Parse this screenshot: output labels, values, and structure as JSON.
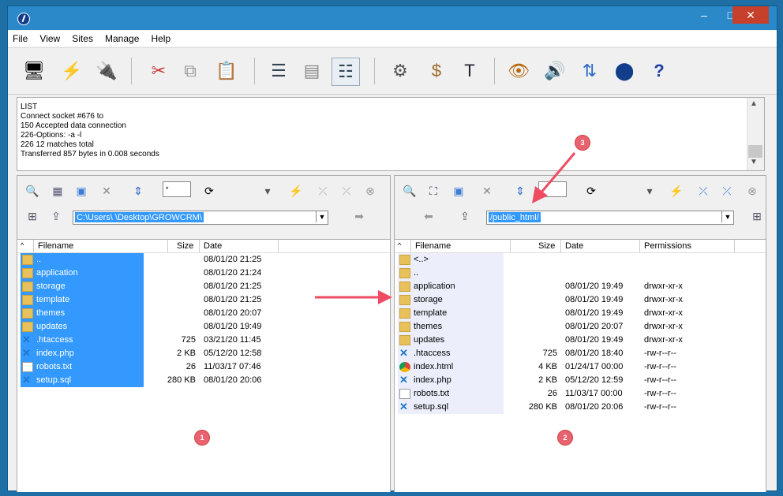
{
  "window": {
    "controls": {
      "minimize": "–",
      "maximize": "□",
      "close": "✕"
    }
  },
  "menu": [
    "File",
    "View",
    "Sites",
    "Manage",
    "Help"
  ],
  "toolbar_icons": [
    "site-manager-icon",
    "quick-connect-icon",
    "disconnect-icon",
    "cut-icon",
    "copy-icon",
    "paste-icon",
    "view-list-icon",
    "view-details-icon",
    "view-report-icon",
    "settings-icon",
    "scheduler-icon",
    "terminal-icon",
    "watch-icon",
    "sound-icon",
    "transfer-icon",
    "about-icon",
    "help-icon"
  ],
  "log": [
    "LIST",
    "Connect socket #676 to",
    "150 Accepted data connection",
    "226-Options: -a -l",
    "226 12 matches total",
    "Transferred 857 bytes in 0.008 seconds"
  ],
  "left": {
    "filter": "*",
    "path": "C:\\Users\\        \\Desktop\\GROWCRM\\",
    "headers": {
      "name": "Filename",
      "size": "Size",
      "date": "Date"
    },
    "files": [
      {
        "name": "..",
        "size": "",
        "date": "08/01/20  21:25",
        "icon": "folder"
      },
      {
        "name": "application",
        "size": "",
        "date": "08/01/20  21:24",
        "icon": "folder"
      },
      {
        "name": "storage",
        "size": "",
        "date": "08/01/20  21:25",
        "icon": "folder"
      },
      {
        "name": "template",
        "size": "",
        "date": "08/01/20  21:25",
        "icon": "folder"
      },
      {
        "name": "themes",
        "size": "",
        "date": "08/01/20  20:07",
        "icon": "folder"
      },
      {
        "name": "updates",
        "size": "",
        "date": "08/01/20  19:49",
        "icon": "folder"
      },
      {
        "name": ".htaccess",
        "size": "725",
        "date": "03/21/20  11:45",
        "icon": "vscode"
      },
      {
        "name": "index.php",
        "size": "2 KB",
        "date": "05/12/20  12:58",
        "icon": "vscode"
      },
      {
        "name": "robots.txt",
        "size": "26",
        "date": "11/03/17  07:46",
        "icon": "txt"
      },
      {
        "name": "setup.sql",
        "size": "280 KB",
        "date": "08/01/20  20:06",
        "icon": "vscode"
      }
    ]
  },
  "right": {
    "filter": "",
    "path": "/public_html/",
    "headers": {
      "name": "Filename",
      "size": "Size",
      "date": "Date",
      "perm": "Permissions"
    },
    "files": [
      {
        "name": "<..>",
        "size": "",
        "date": "",
        "perm": "",
        "icon": "folder"
      },
      {
        "name": "..",
        "size": "",
        "date": "",
        "perm": "",
        "icon": "folder"
      },
      {
        "name": "application",
        "size": "",
        "date": "08/01/20  19:49",
        "perm": "drwxr-xr-x",
        "icon": "folder"
      },
      {
        "name": "storage",
        "size": "",
        "date": "08/01/20  19:49",
        "perm": "drwxr-xr-x",
        "icon": "folder"
      },
      {
        "name": "template",
        "size": "",
        "date": "08/01/20  19:49",
        "perm": "drwxr-xr-x",
        "icon": "folder"
      },
      {
        "name": "themes",
        "size": "",
        "date": "08/01/20  20:07",
        "perm": "drwxr-xr-x",
        "icon": "folder"
      },
      {
        "name": "updates",
        "size": "",
        "date": "08/01/20  19:49",
        "perm": "drwxr-xr-x",
        "icon": "folder"
      },
      {
        "name": ".htaccess",
        "size": "725",
        "date": "08/01/20  18:40",
        "perm": "-rw-r--r--",
        "icon": "vscode"
      },
      {
        "name": "index.html",
        "size": "4 KB",
        "date": "01/24/17  00:00",
        "perm": "-rw-r--r--",
        "icon": "chrome"
      },
      {
        "name": "index.php",
        "size": "2 KB",
        "date": "05/12/20  12:59",
        "perm": "-rw-r--r--",
        "icon": "vscode"
      },
      {
        "name": "robots.txt",
        "size": "26",
        "date": "11/03/17  00:00",
        "perm": "-rw-r--r--",
        "icon": "txt"
      },
      {
        "name": "setup.sql",
        "size": "280 KB",
        "date": "08/01/20  20:06",
        "perm": "-rw-r--r--",
        "icon": "vscode"
      }
    ]
  },
  "badges": [
    "1",
    "2",
    "3"
  ],
  "colors": {
    "selection": "#3399ff",
    "badge": "#e8626f",
    "titlebar": "#2b89c9"
  }
}
